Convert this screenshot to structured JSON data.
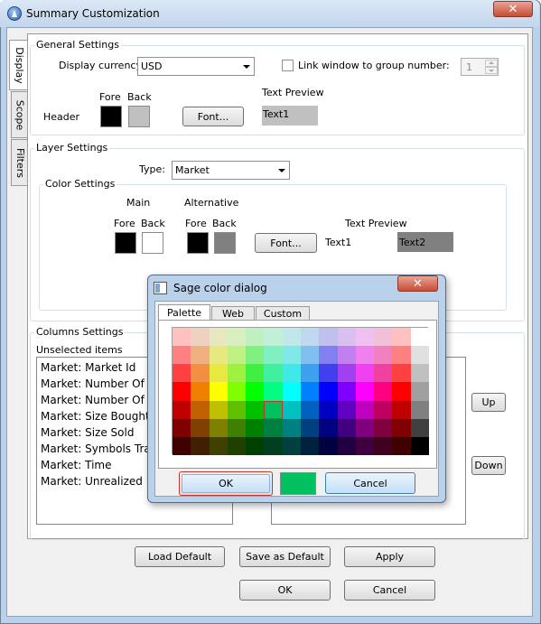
{
  "window": {
    "title": "Summary Customization"
  },
  "tabs": [
    "Display",
    "Scope",
    "Filters"
  ],
  "general": {
    "legend": "General Settings",
    "currency_label": "Display currency:",
    "currency_value": "USD",
    "link_label": "Link window to group number:",
    "link_value": "1",
    "fore_label": "Fore",
    "back_label": "Back",
    "text_preview_label": "Text Preview",
    "header_label": "Header",
    "font_button": "Font...",
    "preview_text": "Text1",
    "colors": {
      "fore": "#000000",
      "back": "#c0c0c0",
      "preview_bg": "#c0c0c0"
    }
  },
  "layer": {
    "legend": "Layer Settings",
    "type_label": "Type:",
    "type_value": "Market",
    "color_legend": "Color Settings",
    "main_label": "Main",
    "alternative_label": "Alternative",
    "fore_label": "Fore",
    "back_label": "Back",
    "text_preview_label": "Text Preview",
    "font_button": "Font...",
    "text1": "Text1",
    "text2": "Text2",
    "colors": {
      "main_fore": "#000000",
      "main_back": "#ffffff",
      "alt_fore": "#000000",
      "alt_back": "#808080",
      "text2_bg": "#808080"
    }
  },
  "columns": {
    "legend": "Columns Settings",
    "unselected_label": "Unselected items",
    "items": [
      "Market: Market Id",
      "Market: Number Of Ot",
      "Market: Number Of Tr",
      "Market: Size Bought",
      "Market: Size Sold",
      "Market: Symbols Trade",
      "Market: Time",
      "Market: Unrealized + N"
    ],
    "up_button": "Up",
    "down_button": "Down"
  },
  "footer": {
    "load_default": "Load Default",
    "save_default": "Save as Default",
    "apply": "Apply",
    "ok": "OK",
    "cancel": "Cancel"
  },
  "dialog": {
    "title": "Sage color dialog",
    "tabs": [
      "Palette",
      "Web",
      "Custom"
    ],
    "ok": "OK",
    "cancel": "Cancel",
    "selected_color": "#00c060",
    "palette": [
      [
        "#ffc0c0",
        "#f0d0c0",
        "#e8e8c0",
        "#d8f0c0",
        "#c0f0c0",
        "#c0f0d8",
        "#c0e8e8",
        "#c0d8f0",
        "#c0c0f0",
        "#d8c0f0",
        "#f0c0f0",
        "#f0c0d8",
        "#ffc0c0",
        "#ffffff"
      ],
      [
        "#ff8080",
        "#f0b080",
        "#e8e880",
        "#c0f080",
        "#80f080",
        "#80f0c0",
        "#80e8e8",
        "#80c0f0",
        "#8080f0",
        "#c080f0",
        "#f080f0",
        "#f080c0",
        "#ff8080",
        "#e0e0e0"
      ],
      [
        "#ff4040",
        "#f09040",
        "#e8e840",
        "#a0f040",
        "#40f040",
        "#40f0a0",
        "#40e8e8",
        "#40a0f0",
        "#4040f0",
        "#a040f0",
        "#f040f0",
        "#f040a0",
        "#ff4040",
        "#c0c0c0"
      ],
      [
        "#ff0000",
        "#f08000",
        "#ffff00",
        "#80ff00",
        "#00ff00",
        "#00ff80",
        "#00ffff",
        "#0080ff",
        "#0000ff",
        "#8000ff",
        "#ff00ff",
        "#ff0080",
        "#ff0000",
        "#a0a0a0"
      ],
      [
        "#c00000",
        "#c06000",
        "#c0c000",
        "#60c000",
        "#00c000",
        "#00c060",
        "#00c0c0",
        "#0060c0",
        "#0000c0",
        "#6000c0",
        "#c000c0",
        "#c00060",
        "#c00000",
        "#808080"
      ],
      [
        "#800000",
        "#804000",
        "#808000",
        "#408000",
        "#008000",
        "#008040",
        "#008080",
        "#004080",
        "#000080",
        "#400080",
        "#800080",
        "#800040",
        "#800000",
        "#404040"
      ],
      [
        "#400000",
        "#402000",
        "#404000",
        "#204000",
        "#004000",
        "#004020",
        "#004040",
        "#002040",
        "#000040",
        "#200040",
        "#400040",
        "#400020",
        "#400000",
        "#000000"
      ]
    ]
  }
}
